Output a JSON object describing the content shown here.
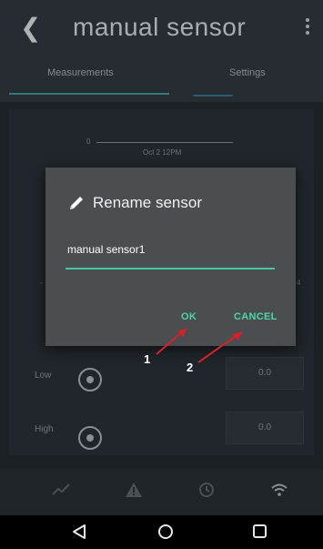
{
  "app": {
    "title": "manual sensor",
    "tabs": [
      {
        "label": "Measurements"
      },
      {
        "label": "Settings"
      }
    ]
  },
  "chart": {
    "zero_label": "0",
    "date_label": "Oct 2 12PM",
    "left_mark": "-",
    "right_mark": "4"
  },
  "rows": [
    {
      "label": "Low",
      "value": "0.0"
    },
    {
      "label": "High",
      "value": "0.0"
    }
  ],
  "bottom_nav": {
    "icons": [
      "chart-icon",
      "warning-icon",
      "history-icon",
      "wifi-icon"
    ]
  },
  "dialog": {
    "title": "Rename sensor",
    "icon": "pencil-icon",
    "input_value": "manual sensor1",
    "ok_label": "OK",
    "cancel_label": "CANCEL"
  },
  "annotations": [
    {
      "label": "1"
    },
    {
      "label": "2"
    }
  ],
  "colors": {
    "accent": "#4fd3ad",
    "dialog_bg": "#4a4e50",
    "arrow": "#d4212a"
  }
}
